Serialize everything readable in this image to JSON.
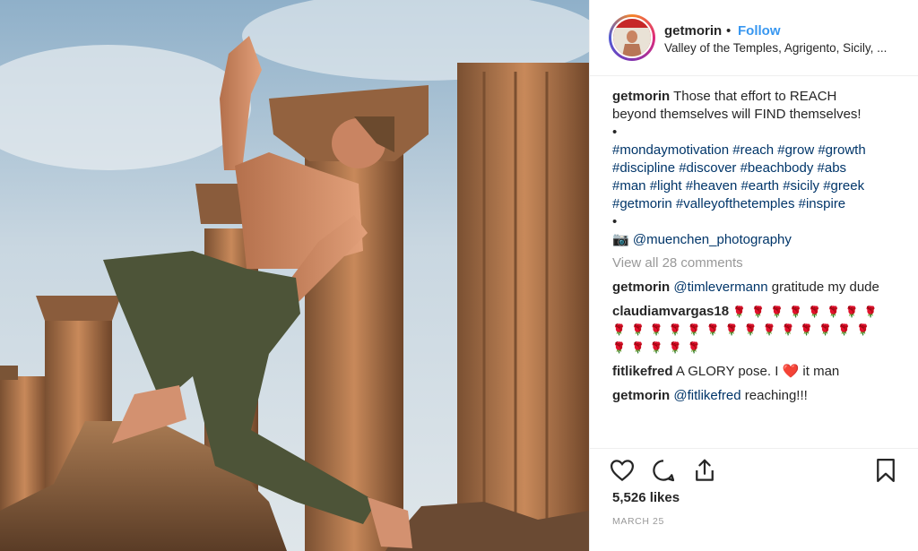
{
  "header": {
    "username": "getmorin",
    "separator": "•",
    "follow_label": "Follow",
    "location": "Valley of the Temples, Agrigento, Sicily, ..."
  },
  "caption": {
    "username": "getmorin",
    "text_line1": "Those that effort to REACH",
    "text_line2": "beyond themselves will FIND themselves!",
    "bullet": "•",
    "hashtags": [
      [
        "#mondaymotivation",
        "#reach",
        "#grow",
        "#growth"
      ],
      [
        "#discipline",
        "#discover",
        "#beachbody",
        "#abs"
      ],
      [
        "#man",
        "#light",
        "#heaven",
        "#earth",
        "#sicily",
        "#greek"
      ],
      [
        "#getmorin",
        "#valleyofthetemples",
        "#inspire"
      ]
    ],
    "camera_emoji": "📷",
    "photographer": "@muenchen_photography"
  },
  "view_all_comments": "View all 28 comments",
  "comments": [
    {
      "username": "getmorin",
      "mention": "@timlevermann",
      "text": "gratitude my dude"
    },
    {
      "username": "claudiamvargas18",
      "roses_line1": "🌹🌹🌹🌹🌹🌹🌹🌹",
      "roses_line2": "🌹🌹🌹🌹🌹🌹🌹🌹🌹🌹🌹🌹🌹🌹",
      "roses_line3": "🌹🌹🌹🌹🌹"
    },
    {
      "username": "fitlikefred",
      "text_before": "A GLORY pose. I",
      "heart": "❤️",
      "text_after": "it man"
    },
    {
      "username": "getmorin",
      "mention": "@fitlikefred",
      "text": "reaching!!!"
    }
  ],
  "likes": "5,526 likes",
  "date": "MARCH 25",
  "icons": [
    "heart-icon",
    "comment-icon",
    "share-icon",
    "bookmark-icon"
  ],
  "colors": {
    "link": "#3897f0",
    "hashtag": "#003569",
    "muted": "#999999",
    "heart": "#ed4956"
  }
}
